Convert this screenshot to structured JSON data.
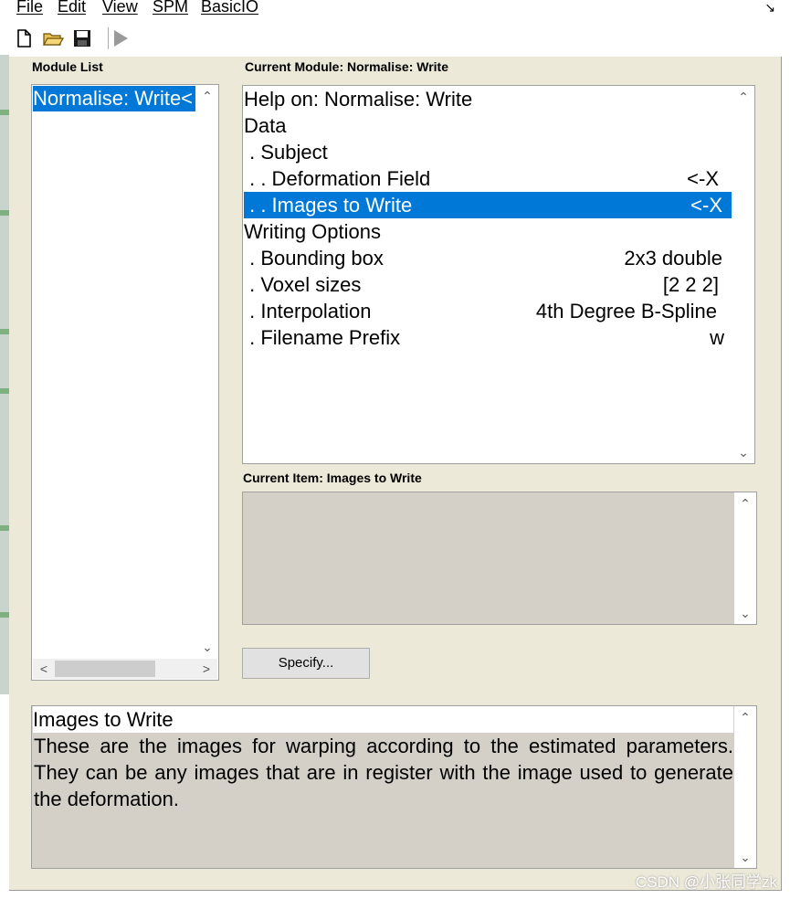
{
  "menu": {
    "items": [
      "File",
      "Edit",
      "View",
      "SPM",
      "BasicIO"
    ]
  },
  "toolbar": {
    "icons": [
      "new-file-icon",
      "open-folder-icon",
      "save-icon",
      "run-icon"
    ]
  },
  "module_list": {
    "label": "Module List",
    "items": [
      "Normalise: Write<"
    ]
  },
  "current_module": {
    "label": "Current Module: Normalise: Write",
    "rows": [
      {
        "text": "Help on: Normalise: Write",
        "value": ""
      },
      {
        "text": "Data",
        "value": ""
      },
      {
        "text": " . Subject",
        "value": ""
      },
      {
        "text": " . . Deformation Field",
        "value": "<-X"
      },
      {
        "text": " . . Images to Write",
        "value": "<-X"
      },
      {
        "text": "Writing Options",
        "value": ""
      },
      {
        "text": " . Bounding box",
        "value": "2x3 double"
      },
      {
        "text": " . Voxel sizes",
        "value": "[2 2 2]"
      },
      {
        "text": " . Interpolation",
        "value": "4th Degree B-Spline"
      },
      {
        "text": " . Filename Prefix",
        "value": "w"
      }
    ],
    "selected_index": 4
  },
  "current_item": {
    "label": "Current Item: Images to Write",
    "specify_label": "Specify..."
  },
  "help": {
    "title": "Images to Write",
    "body": "These are the images for warping according to the estimated parameters. They can be any images that are in register with the image used to generate the deformation."
  },
  "watermark": "CSDN @小张同学zk",
  "colors": {
    "selection": "#0078d7",
    "window_bg": "#ece9d8",
    "panel_gray": "#d4d0c8"
  }
}
